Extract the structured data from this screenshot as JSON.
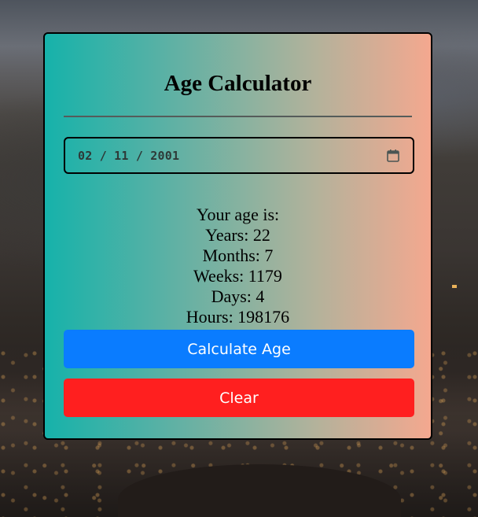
{
  "app": {
    "title": "Age Calculator"
  },
  "date_input": {
    "value": "02 / 11 / 2001",
    "icon": "calendar-icon"
  },
  "result": {
    "heading": "Your age is:",
    "years": "Years: 22",
    "months": "Months: 7",
    "weeks": "Weeks: 1179",
    "days": "Days: 4",
    "hours": "Hours: 198176"
  },
  "buttons": {
    "calculate_label": "Calculate Age",
    "clear_label": "Clear"
  },
  "colors": {
    "calculate_bg": "#0a7cff",
    "clear_bg": "#ff1f1f",
    "card_gradient_start": "#16b2aa",
    "card_gradient_end": "#f4a88f"
  }
}
